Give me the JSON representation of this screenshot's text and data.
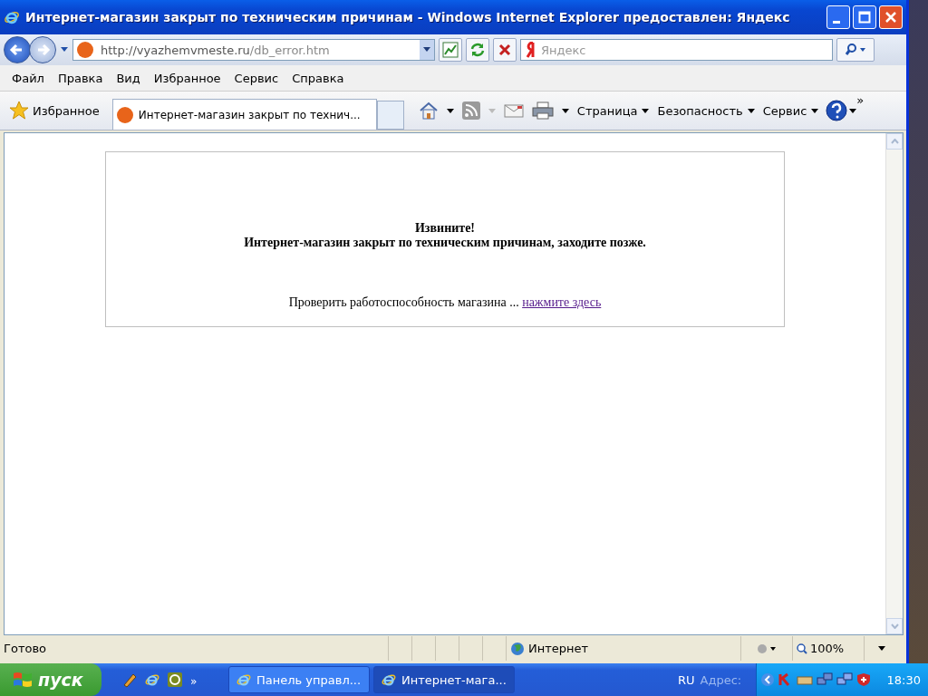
{
  "window": {
    "title": "Интернет-магазин закрыт по техническим причинам - Windows Internet Explorer предоставлен: Яндекс"
  },
  "address_bar": {
    "url_host": "http://vyazhemvmeste.ru",
    "url_path": "/db_error.htm",
    "search_placeholder": "Яндекс"
  },
  "menu": [
    "Файл",
    "Правка",
    "Вид",
    "Избранное",
    "Сервис",
    "Справка"
  ],
  "command_bar": {
    "favorites": "Избранное",
    "tab": {
      "label": "Интернет-магазин закрыт по технич...",
      "selected": true
    },
    "menus": [
      "Страница",
      "Безопасность",
      "Сервис"
    ],
    "more": "»"
  },
  "page": {
    "heading": "Извините!",
    "message": "Интернет-магазин закрыт по техническим причинам, заходите позже.",
    "check_text": "Проверить работоспособность магазина ...",
    "check_link": "нажмите здесь"
  },
  "status_bar": {
    "status": "Готово",
    "zone": "Интернет",
    "zoom": "100%"
  },
  "taskbar": {
    "start": "пуск",
    "more": "»",
    "tasks": [
      {
        "label": "Панель управл...",
        "selected": false
      },
      {
        "label": "Интернет-мага...",
        "selected": true
      }
    ],
    "language": "RU",
    "address_label": "Адрес:",
    "clock": "18:30"
  }
}
